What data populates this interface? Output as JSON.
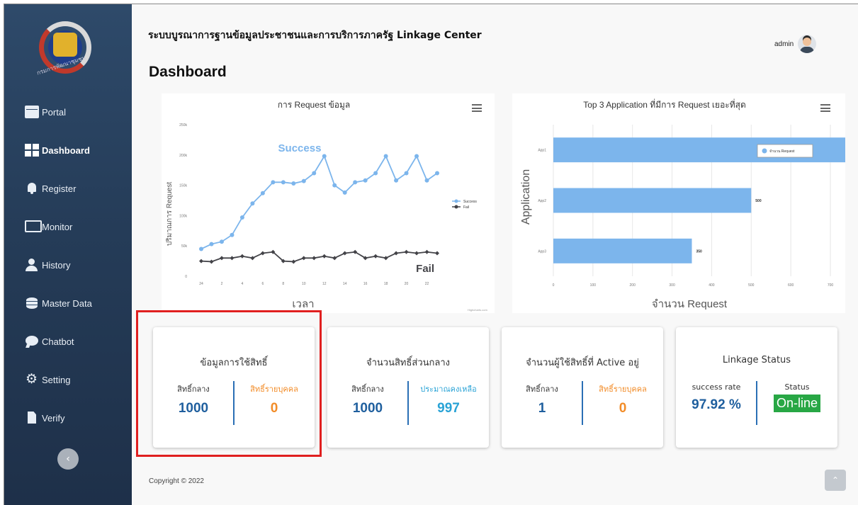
{
  "app_title": "ระบบบูรณาการฐานข้อมูลประชาชนและการบริการภาครัฐ Linkage Center",
  "user": {
    "name": "admin"
  },
  "page_title": "Dashboard",
  "sidebar": {
    "logo_caption": "กรมการพัฒนาชุมชน",
    "items": [
      {
        "label": "Portal",
        "icon": "portal-icon"
      },
      {
        "label": "Dashboard",
        "icon": "dashboard-icon",
        "active": true
      },
      {
        "label": "Register",
        "icon": "bell-icon"
      },
      {
        "label": "Monitor",
        "icon": "monitor-icon"
      },
      {
        "label": "History",
        "icon": "user-icon"
      },
      {
        "label": "Master Data",
        "icon": "database-icon"
      },
      {
        "label": "Chatbot",
        "icon": "chat-icon"
      },
      {
        "label": "Setting",
        "icon": "gear-icon"
      },
      {
        "label": "Verify",
        "icon": "file-icon"
      }
    ],
    "collapse_glyph": "‹"
  },
  "chart_data": [
    {
      "type": "line",
      "title": "การ Request ข้อมูล",
      "xlabel": "เวลา",
      "ylabel": "ปริมาณการ Request",
      "x_ticks": [
        "24",
        "2",
        "4",
        "6",
        "8",
        "10",
        "12",
        "14",
        "16",
        "18",
        "20",
        "22"
      ],
      "y_ticks": [
        "0",
        "50k",
        "100k",
        "150k",
        "200k",
        "250k"
      ],
      "ylim": [
        0,
        250000
      ],
      "series": [
        {
          "name": "Success",
          "color": "#7cb5ec",
          "annotation": "Success",
          "values": [
            45000,
            53000,
            57000,
            68000,
            97000,
            120000,
            137000,
            155000,
            155000,
            153000,
            157000,
            170000,
            198000,
            150000,
            138000,
            155000,
            158000,
            170000,
            198000,
            158000,
            170000,
            198000,
            158000,
            170000
          ]
        },
        {
          "name": "Fail",
          "color": "#434348",
          "annotation": "Fail",
          "values": [
            25000,
            24000,
            30000,
            30000,
            33000,
            30000,
            38000,
            40000,
            25000,
            24000,
            30000,
            30000,
            33000,
            30000,
            38000,
            40000,
            30000,
            33000,
            30000,
            38000,
            40000,
            38000,
            40000,
            38000
          ]
        }
      ],
      "legend": "right",
      "credits": "Highcharts.com"
    },
    {
      "type": "bar",
      "orientation": "horizontal",
      "title": "Top 3 Application ที่มีการ Request เยอะที่สุด",
      "xlabel": "จำนวน Request",
      "ylabel": "Application",
      "categories": [
        "App1",
        "App2",
        "App3"
      ],
      "series": [
        {
          "name": "จำนวน Request",
          "color": "#7cb5ec",
          "values": [
            800,
            500,
            350
          ]
        }
      ],
      "data_labels": [
        "",
        "500",
        "350"
      ],
      "x_ticks": [
        "0",
        "100",
        "200",
        "300",
        "400",
        "500",
        "600",
        "700"
      ],
      "xlim": [
        0,
        700
      ],
      "legend": "top-right"
    }
  ],
  "cards": [
    {
      "title": "ข้อมูลการใช้สิทธิ์",
      "left_label": "สิทธิ์กลาง",
      "left_value": "1000",
      "right_label": "สิทธิ์รายบุคคล",
      "right_value": "0"
    },
    {
      "title": "จำนวนสิทธิ์ส่วนกลาง",
      "left_label": "สิทธิ์กลาง",
      "left_value": "1000",
      "right_label": "ประมาณคงเหลือ",
      "right_value": "997"
    },
    {
      "title": "จำนวนผู้ใช้สิทธิ์ที่ Active อยู่",
      "left_label": "สิทธิ์กลาง",
      "left_value": "1",
      "right_label": "สิทธิ์รายบุคคล",
      "right_value": "0"
    },
    {
      "title": "Linkage Status",
      "left_label": "success rate",
      "left_value": "97.92 %",
      "right_label": "Status",
      "right_value": "On-line"
    }
  ],
  "footer": "Copyright © 2022",
  "scroll_top_glyph": "⌃"
}
